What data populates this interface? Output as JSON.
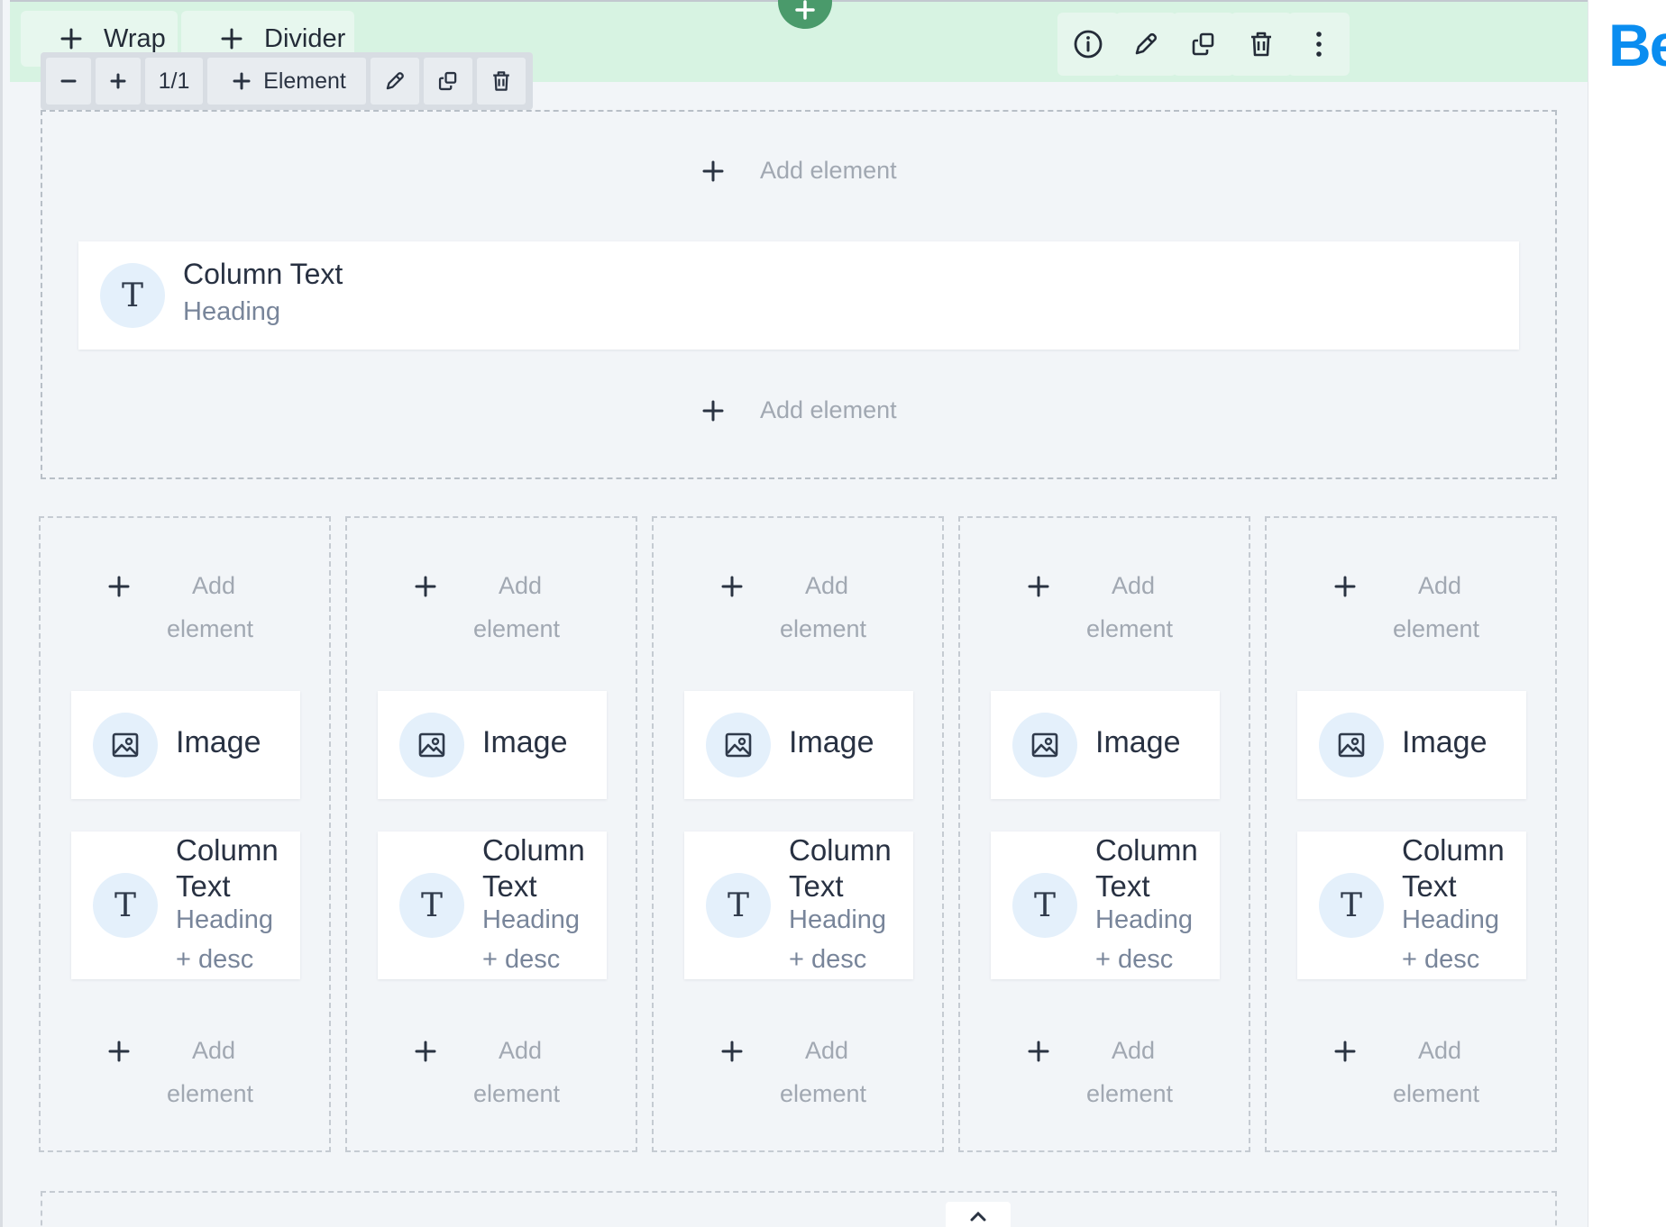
{
  "section": {
    "add_section_symbol": "+",
    "wrap_label": "Wrap",
    "divider_label": "Divider",
    "icons": [
      "info-icon",
      "pencil-icon",
      "clone-icon",
      "trash-icon",
      "more-vertical-icon"
    ],
    "accent_color": "#d7f3e2"
  },
  "wrap_toolbar": {
    "size": "1/1",
    "element_label": "Element"
  },
  "wrap": {
    "add_top": "Add element",
    "item": {
      "title": "Column Text",
      "subtitle": "Heading",
      "icon": "T"
    },
    "add_bottom": "Add element"
  },
  "columns": [
    {
      "add_top": [
        "Add",
        "element"
      ],
      "image_label": "Image",
      "text_title": [
        "Column",
        "Text"
      ],
      "text_sub": [
        "Heading",
        "+ desc"
      ],
      "text_icon": "T",
      "add_bottom": [
        "Add",
        "element"
      ]
    },
    {
      "add_top": [
        "Add",
        "element"
      ],
      "image_label": "Image",
      "text_title": [
        "Column",
        "Text"
      ],
      "text_sub": [
        "Heading",
        "+ desc"
      ],
      "text_icon": "T",
      "add_bottom": [
        "Add",
        "element"
      ]
    },
    {
      "add_top": [
        "Add",
        "element"
      ],
      "image_label": "Image",
      "text_title": [
        "Column",
        "Text"
      ],
      "text_sub": [
        "Heading",
        "+ desc"
      ],
      "text_icon": "T",
      "add_bottom": [
        "Add",
        "element"
      ]
    },
    {
      "add_top": [
        "Add",
        "element"
      ],
      "image_label": "Image",
      "text_title": [
        "Column",
        "Text"
      ],
      "text_sub": [
        "Heading",
        "+ desc"
      ],
      "text_icon": "T",
      "add_bottom": [
        "Add",
        "element"
      ]
    },
    {
      "add_top": [
        "Add",
        "element"
      ],
      "image_label": "Image",
      "text_title": [
        "Column",
        "Text"
      ],
      "text_sub": [
        "Heading",
        "+ desc"
      ],
      "text_icon": "T",
      "add_bottom": [
        "Add",
        "element"
      ]
    }
  ],
  "right_panel": {
    "brand_text": "Be",
    "brand_color": "#0a8df0"
  }
}
